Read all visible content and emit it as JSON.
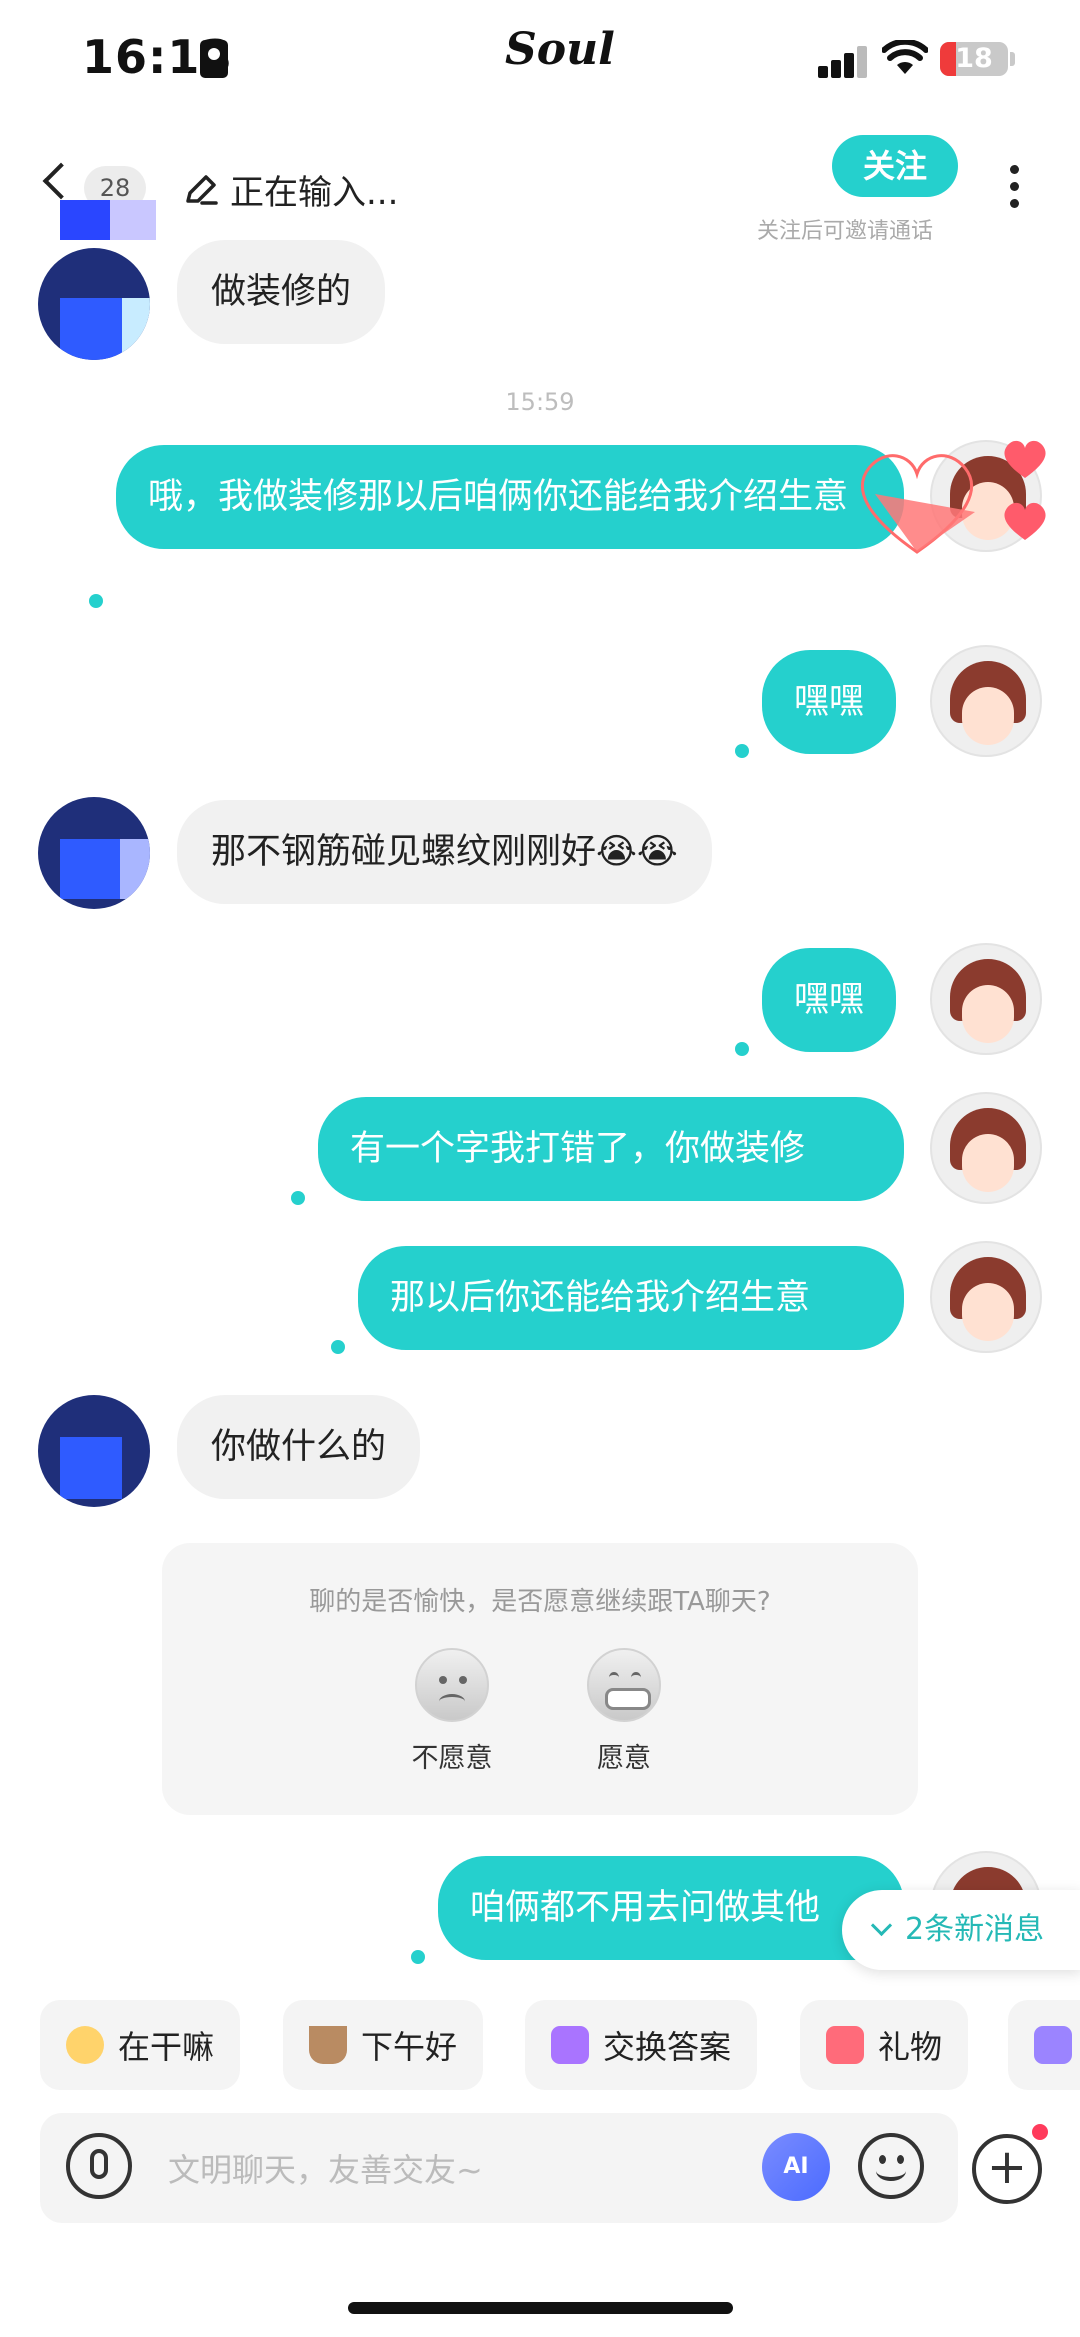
{
  "status_bar": {
    "time": "16:13",
    "app_brand": "Soul",
    "battery": "18"
  },
  "header": {
    "unread_count": "28",
    "typing_status": "正在输入...",
    "follow_label": "关注",
    "follow_hint": "关注后可邀请通话",
    "icons": [
      "back-icon",
      "edit-icon",
      "more-icon"
    ]
  },
  "timestamp": "15:59",
  "messages": [
    {
      "from": "them",
      "text": "做装修的"
    },
    {
      "from": "me",
      "text": "哦，我做装修那以后咱俩你还能给我介绍生意"
    },
    {
      "from": "me",
      "text": "嘿嘿"
    },
    {
      "from": "them",
      "text": "那不钢筋碰见螺纹刚刚好😭😭"
    },
    {
      "from": "me",
      "text": "嘿嘿"
    },
    {
      "from": "me",
      "text": "有一个字我打错了，你做装修"
    },
    {
      "from": "me",
      "text": "那以后你还能给我介绍生意"
    },
    {
      "from": "them",
      "text": "你做什么的"
    },
    {
      "from": "me",
      "text": "咱俩都不用去问做其他"
    }
  ],
  "survey": {
    "question": "聊的是否愉快，是否愿意继续跟TA聊天?",
    "option_no": "不愿意",
    "option_yes": "愿意"
  },
  "new_messages": "2条新消息",
  "quick_chips": [
    {
      "label": "在干嘛",
      "icon": "emoji-icon"
    },
    {
      "label": "下午好",
      "icon": "coffee-icon"
    },
    {
      "label": "交换答案",
      "icon": "swap-icon"
    },
    {
      "label": "礼物",
      "icon": "gift-icon"
    }
  ],
  "input": {
    "placeholder": "文明聊天，友善交友~",
    "ai_label": "AI"
  },
  "colors": {
    "accent": "#25d0cd",
    "bubble_in": "#f1f1f1"
  }
}
